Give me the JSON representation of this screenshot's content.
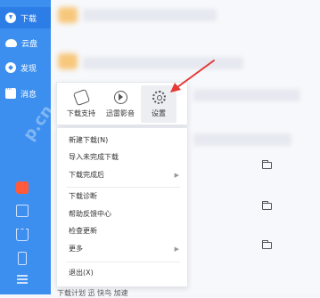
{
  "sidebar": {
    "items": [
      {
        "label": "下载",
        "icon": "download-icon"
      },
      {
        "label": "云盘",
        "icon": "cloud-icon"
      },
      {
        "label": "发现",
        "icon": "discover-icon"
      },
      {
        "label": "消息",
        "icon": "message-icon"
      }
    ],
    "bottom_icons": [
      "red-app-icon",
      "gamepad-icon",
      "crown-icon",
      "phone-icon",
      "menu-icon"
    ],
    "watermark": "p.cn"
  },
  "toolbar": {
    "items": [
      {
        "label": "下载支持",
        "icon": "share-icon"
      },
      {
        "label": "迅雷影音",
        "icon": "player-icon"
      },
      {
        "label": "设置",
        "icon": "gear-icon"
      }
    ]
  },
  "menu": {
    "items": [
      {
        "label": "新建下载(N)"
      },
      {
        "label": "导入未完成下载"
      },
      {
        "label": "下载完成后",
        "submenu": true
      },
      {
        "label": "下载诊断"
      },
      {
        "label": "帮助反馈中心"
      },
      {
        "label": "检查更新"
      },
      {
        "label": "更多",
        "submenu": true
      },
      {
        "label": "退出(X)"
      }
    ]
  },
  "status_bar": {
    "text": "下载计划  迅 快鸟  加速"
  },
  "colors": {
    "sidebar": "#3d8fef",
    "sidebar_active": "#2d7de6",
    "annotation": "#e53935"
  }
}
